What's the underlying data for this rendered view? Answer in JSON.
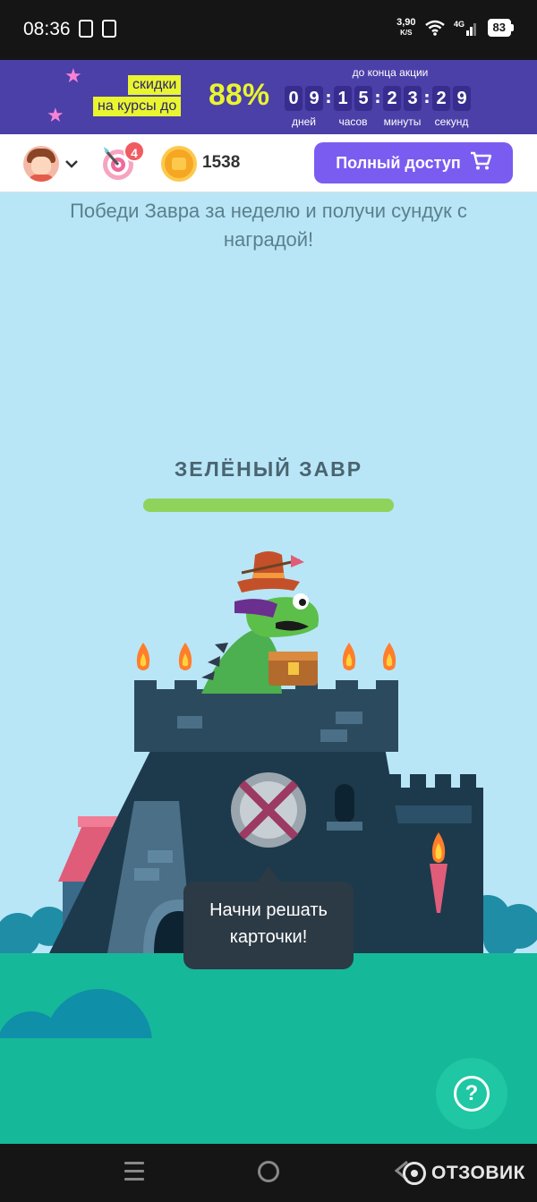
{
  "status_bar": {
    "time": "08:36",
    "net_speed": "3,90",
    "net_unit": "K/S",
    "network": "4G",
    "battery": "83"
  },
  "promo": {
    "label_line1": "скидки",
    "label_line2": "на курсы до",
    "percent": "88%",
    "timer_title": "до конца акции",
    "timer": [
      {
        "digits": [
          "0",
          "9"
        ],
        "unit": "дней"
      },
      {
        "digits": [
          "1",
          "5"
        ],
        "unit": "часов"
      },
      {
        "digits": [
          "2",
          "3"
        ],
        "unit": "минуты"
      },
      {
        "digits": [
          "2",
          "9"
        ],
        "unit": "секунд"
      }
    ],
    "colors": {
      "background": "#4b3fa8",
      "accent": "#e9f52f"
    }
  },
  "header": {
    "target_badge": "4",
    "coins": "1538",
    "full_access_label": "Полный доступ",
    "colors": {
      "button": "#7a5cf0",
      "badge": "#f15b62"
    }
  },
  "main": {
    "challenge_text": "Победи Завра за неделю и получи сундук с наградой!",
    "boss_name": "ЗЕЛЁНЫЙ ЗАВР",
    "boss_hp": 1.0,
    "tooltip_line1": "Начни решать",
    "tooltip_line2": "карточки!",
    "help_label": "?"
  },
  "watermark": "ОТЗОВИК"
}
